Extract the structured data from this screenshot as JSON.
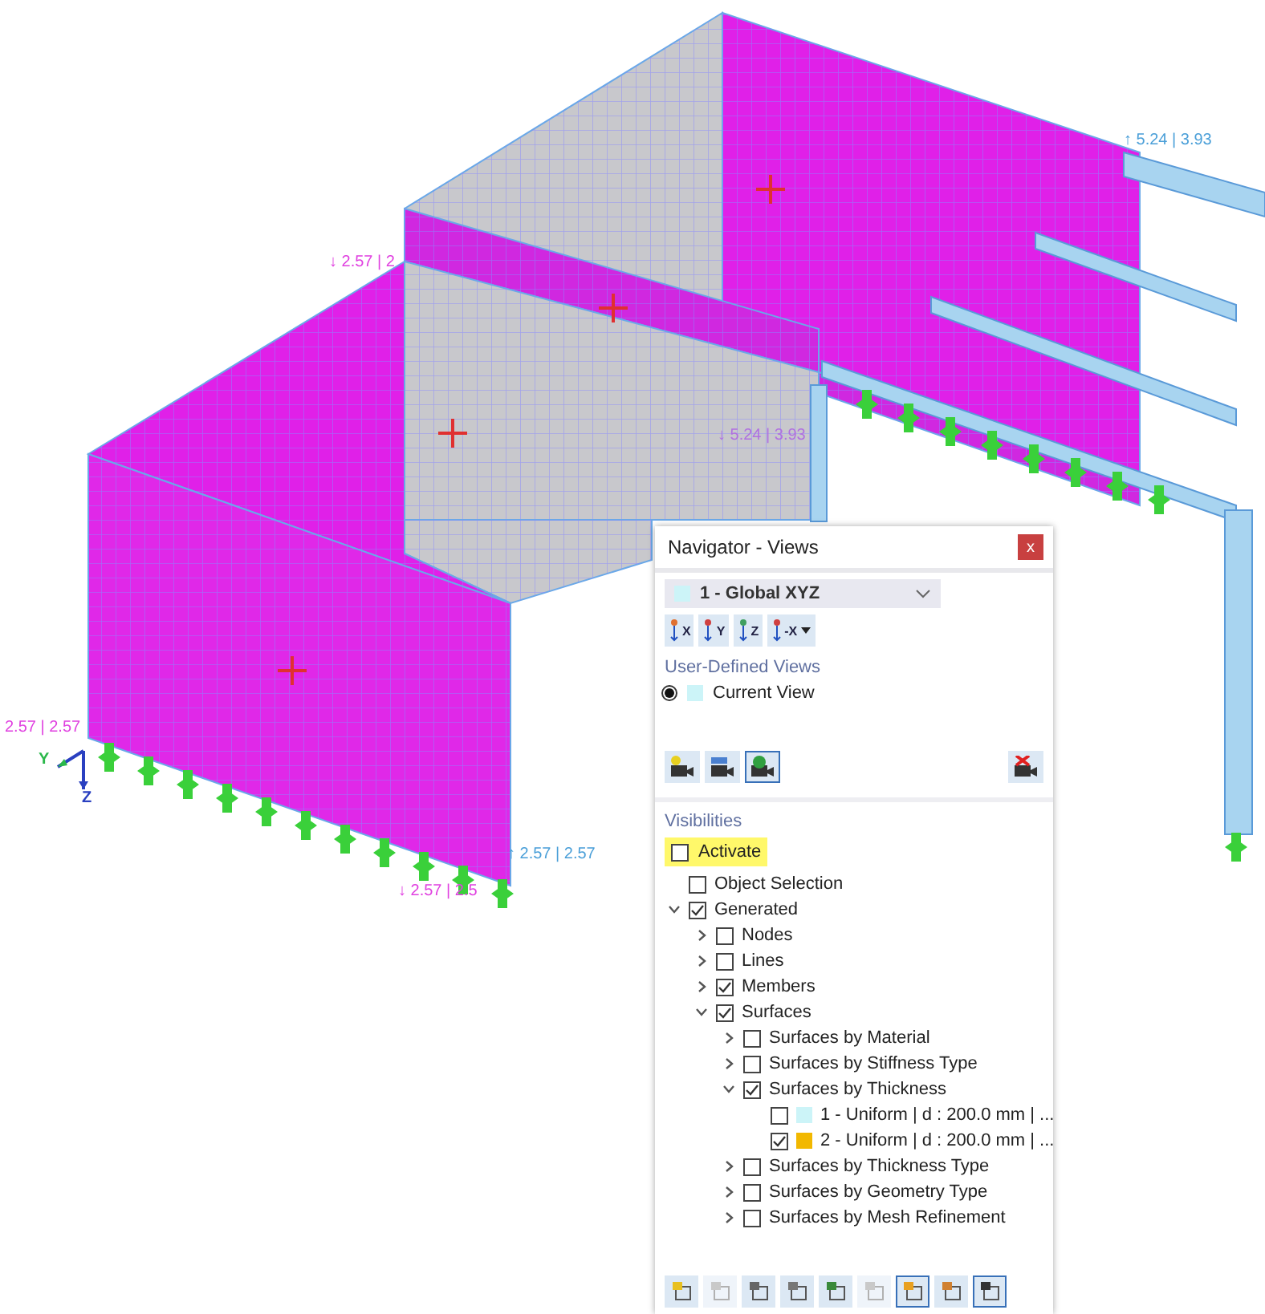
{
  "model": {
    "result_labels": [
      {
        "text": "↓ 2.57 | 2",
        "color": "#e040e0"
      },
      {
        "text": "↑ 5.24 | 3.93",
        "color": "#4a9fd8"
      },
      {
        "text": "↓ 5.24 | 3.93",
        "color": "#b070e0"
      },
      {
        "text": "2.57 | 2.57",
        "color": "#e040e0"
      },
      {
        "text": "↑ 2.57 | 2.57",
        "color": "#4a9fd8"
      },
      {
        "text": "↓ 2.57 | 2.5",
        "color": "#e040e0"
      }
    ],
    "axes": [
      "Y",
      "Z"
    ]
  },
  "navigator": {
    "title": "Navigator - Views",
    "close": "x",
    "view_select": {
      "value": "1 - Global XYZ"
    },
    "view_buttons": [
      {
        "label": "X",
        "kind": "plain"
      },
      {
        "label": "Y",
        "kind": "plain"
      },
      {
        "label": "Z",
        "kind": "plain"
      },
      {
        "label": "-X",
        "kind": "split"
      }
    ],
    "user_views_heading": "User-Defined Views",
    "user_views": [
      {
        "label": "Current View",
        "selected": true
      }
    ],
    "camera_buttons": [
      {
        "kind": "new",
        "selected": false
      },
      {
        "kind": "edit",
        "selected": false
      },
      {
        "kind": "apply",
        "selected": true
      },
      {
        "kind": "delete",
        "selected": false
      }
    ],
    "visibilities_heading": "Visibilities",
    "activate": {
      "label": "Activate",
      "checked": false
    },
    "tree": [
      {
        "label": "Object Selection",
        "checked": false
      },
      {
        "label": "Generated",
        "checked": true,
        "expanded": true,
        "children": [
          {
            "label": "Nodes",
            "checked": false,
            "expanded": false
          },
          {
            "label": "Lines",
            "checked": false,
            "expanded": false
          },
          {
            "label": "Members",
            "checked": true,
            "expanded": false
          },
          {
            "label": "Surfaces",
            "checked": true,
            "expanded": true,
            "children": [
              {
                "label": "Surfaces by Material",
                "checked": false,
                "expanded": false
              },
              {
                "label": "Surfaces by Stiffness Type",
                "checked": false,
                "expanded": false
              },
              {
                "label": "Surfaces by Thickness",
                "checked": true,
                "expanded": true,
                "children": [
                  {
                    "label": "1 - Uniform | d : 200.0 mm | ...",
                    "checked": false,
                    "color": "#ccf4f8"
                  },
                  {
                    "label": "2 - Uniform | d : 200.0 mm | ...",
                    "checked": true,
                    "color": "#f2b800"
                  }
                ]
              },
              {
                "label": "Surfaces by Thickness Type",
                "checked": false,
                "expanded": false
              },
              {
                "label": "Surfaces by Geometry Type",
                "checked": false,
                "expanded": false
              },
              {
                "label": "Surfaces by Mesh Refinement",
                "checked": false,
                "expanded": false
              }
            ]
          }
        ]
      }
    ],
    "toolbar": [
      {
        "selected": false,
        "disabled": false
      },
      {
        "selected": false,
        "disabled": true
      },
      {
        "selected": false,
        "disabled": false
      },
      {
        "selected": false,
        "disabled": false
      },
      {
        "selected": false,
        "disabled": false
      },
      {
        "selected": false,
        "disabled": true
      },
      {
        "selected": true,
        "disabled": false
      },
      {
        "selected": false,
        "disabled": false
      },
      {
        "selected": true,
        "disabled": false
      }
    ]
  }
}
